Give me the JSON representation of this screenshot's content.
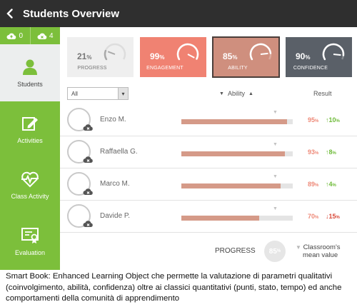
{
  "header": {
    "title": "Students Overview"
  },
  "sidebar": {
    "cloud_up_count": "0",
    "cloud_down_count": "4",
    "items": [
      {
        "label": "Students",
        "icon": "student-icon"
      },
      {
        "label": "Activities",
        "icon": "edit-icon"
      },
      {
        "label": "Class Activity",
        "icon": "heartbeat-icon"
      },
      {
        "label": "Evaluation",
        "icon": "certificate-icon"
      }
    ]
  },
  "cards": [
    {
      "value": "21",
      "unit": "%",
      "label": "PROGRESS",
      "level": 0.21
    },
    {
      "value": "99",
      "unit": "%",
      "label": "ENGAGEMENT",
      "level": 0.99
    },
    {
      "value": "85",
      "unit": "%",
      "label": "ABILITY",
      "level": 0.85
    },
    {
      "value": "90",
      "unit": "%",
      "label": "CONFIDENCE",
      "level": 0.9
    }
  ],
  "filters": {
    "select_value": "All",
    "sort_label": "Ability",
    "result_label": "Result"
  },
  "students": [
    {
      "name": "Enzo M.",
      "ability": 0.95,
      "score": "95",
      "unit": "%",
      "delta": "10",
      "delta_unit": "%",
      "direction": "up"
    },
    {
      "name": "Raffaella G.",
      "ability": 0.93,
      "score": "93",
      "unit": "%",
      "delta": "8",
      "delta_unit": "%",
      "direction": "up"
    },
    {
      "name": "Marco M.",
      "ability": 0.89,
      "score": "89",
      "unit": "%",
      "delta": "4",
      "delta_unit": "%",
      "direction": "up"
    },
    {
      "name": "Davide P.",
      "ability": 0.7,
      "score": "70",
      "unit": "%",
      "delta": "15",
      "delta_unit": "%",
      "direction": "down"
    }
  ],
  "footer": {
    "progress_label": "PROGRESS",
    "progress_value": "85",
    "progress_unit": "%",
    "mean_line1": "Classroom's",
    "mean_line2": "mean value"
  },
  "caption": "Smart Book: Enhanced Learning Object che permette la valutazione di parametri qualitativi (coinvolgimento, abilità, confidenza) oltre ai classici quantitativi (punti, stato, tempo) ed anche comportamenti della comunità di apprendimento",
  "colors": {
    "header": "#2f2f2f",
    "sidebar_green": "#7cbf3b",
    "engagement": "#f08272",
    "ability": "#cf8f7e",
    "confidence": "#5a6068",
    "positive": "#6fbb3a",
    "negative": "#d94b3b"
  }
}
